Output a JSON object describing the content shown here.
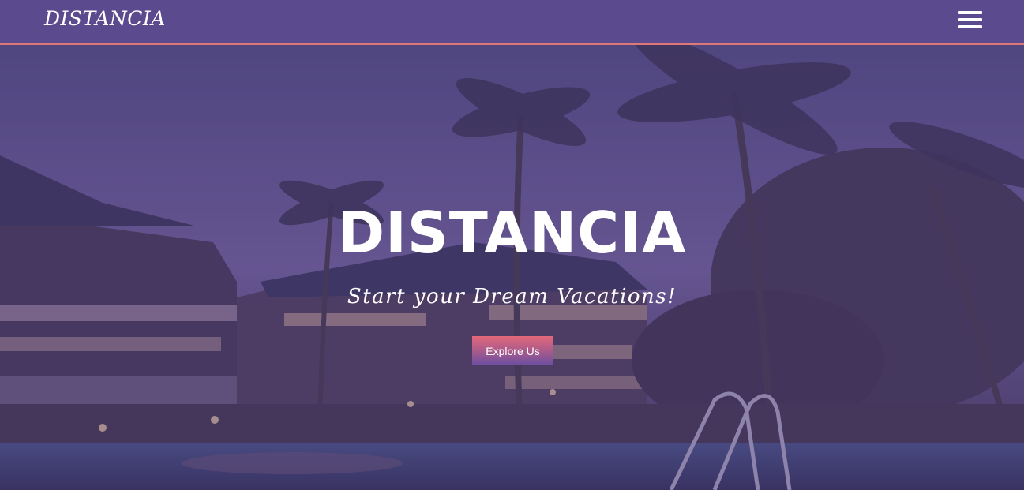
{
  "navbar": {
    "brand": "DISTANCIA",
    "menu_icon": "hamburger-menu-icon",
    "background_color": "#5c4a8f",
    "border_color": "#e0787a"
  },
  "hero": {
    "title": "DISTANCIA",
    "subtitle": "Start your Dream Vacations!",
    "cta_label": "Explore Us",
    "overlay_color": "#5c4a8f"
  }
}
